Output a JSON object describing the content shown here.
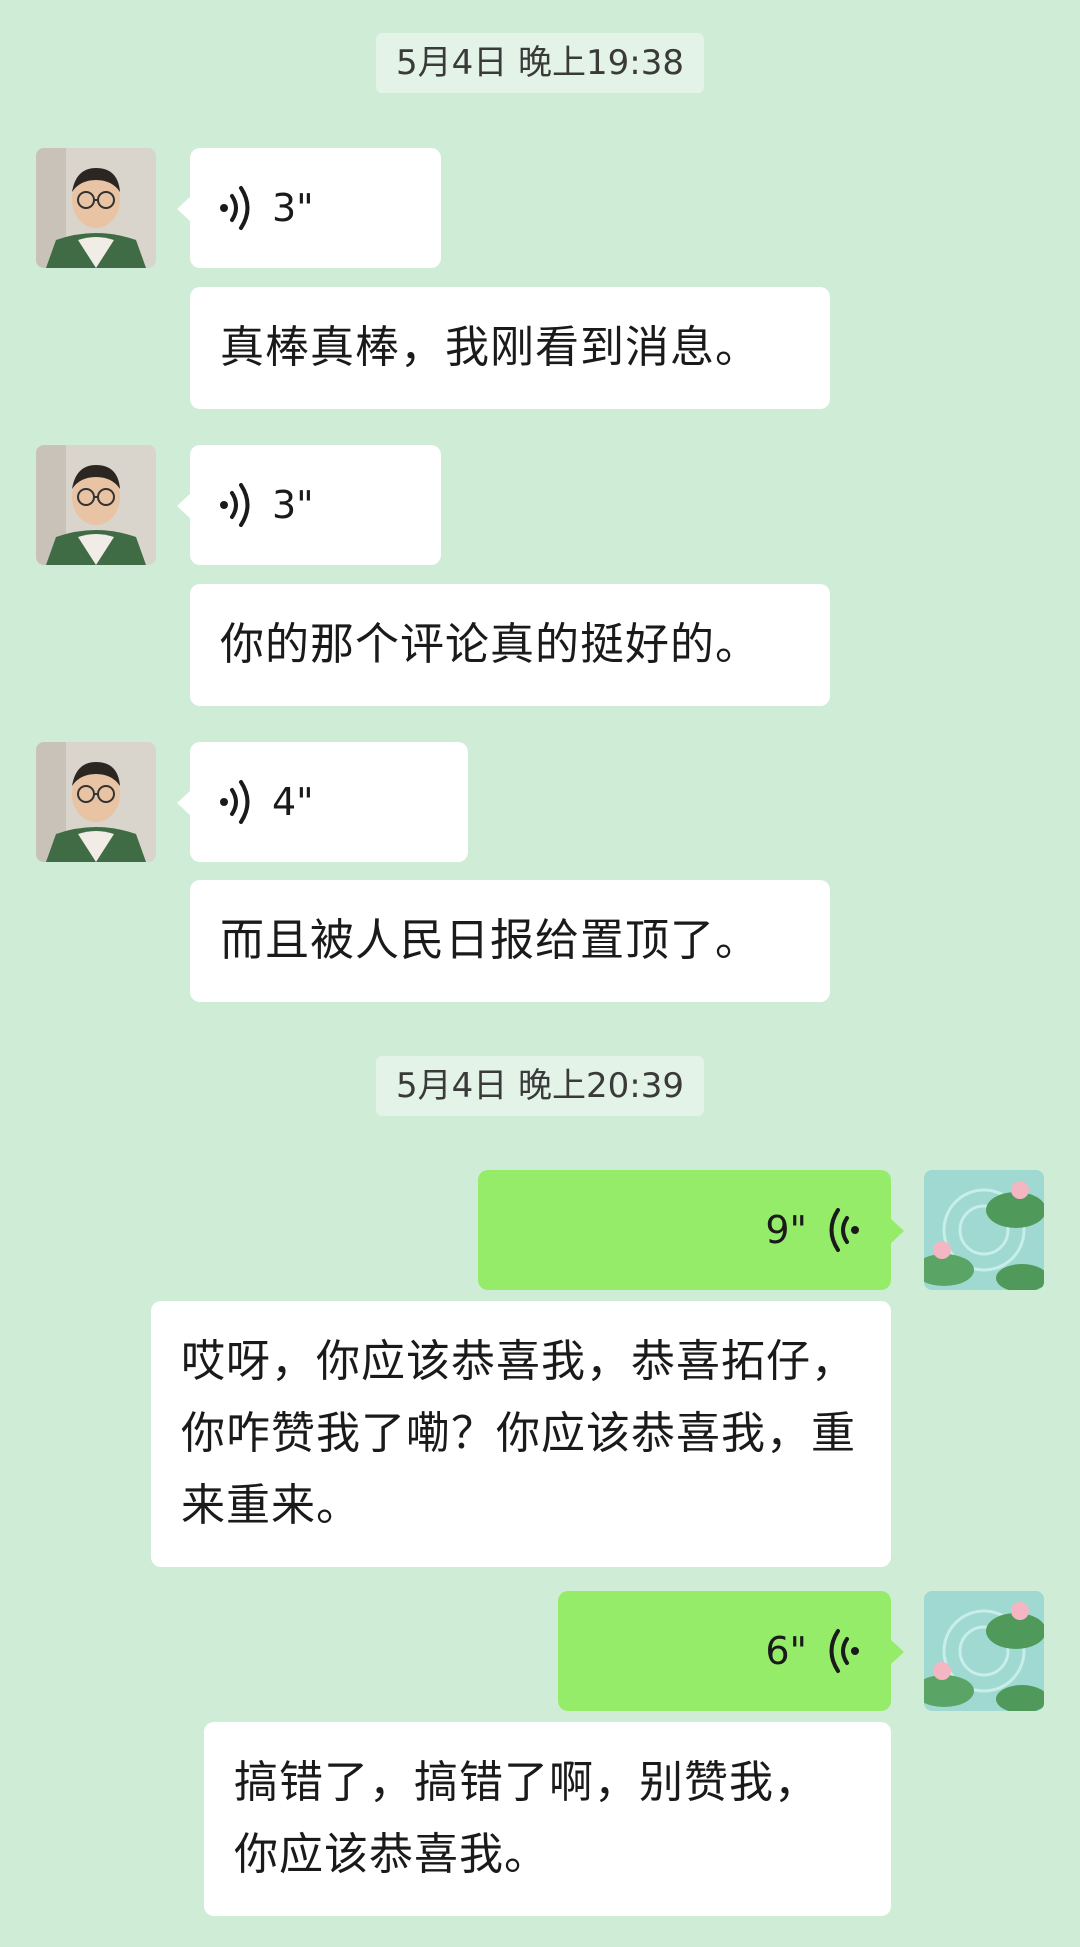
{
  "chat": {
    "timestamp1": "5月4日 晚上19:38",
    "timestamp2": "5月4日 晚上20:39",
    "messages": [
      {
        "side": "left",
        "voice_duration": "3\"",
        "transcript": "真棒真棒，我刚看到消息。"
      },
      {
        "side": "left",
        "voice_duration": "3\"",
        "transcript": "你的那个评论真的挺好的。"
      },
      {
        "side": "left",
        "voice_duration": "4\"",
        "transcript": "而且被人民日报给置顶了。"
      },
      {
        "side": "right",
        "voice_duration": "9\"",
        "transcript": "哎呀，你应该恭喜我，恭喜拓仔，你咋赞我了嘞？你应该恭喜我，重来重来。"
      },
      {
        "side": "right",
        "voice_duration": "6\"",
        "transcript": "搞错了，搞错了啊，别赞我，你应该恭喜我。"
      }
    ],
    "icons": {
      "left_avatar": "man-with-glasses-avatar",
      "right_avatar": "lotus-pond-avatar",
      "voice": "voice-wave-icon"
    },
    "colors": {
      "background": "#cfecd6",
      "incoming_bubble": "#ffffff",
      "outgoing_bubble": "#95ec69"
    }
  }
}
